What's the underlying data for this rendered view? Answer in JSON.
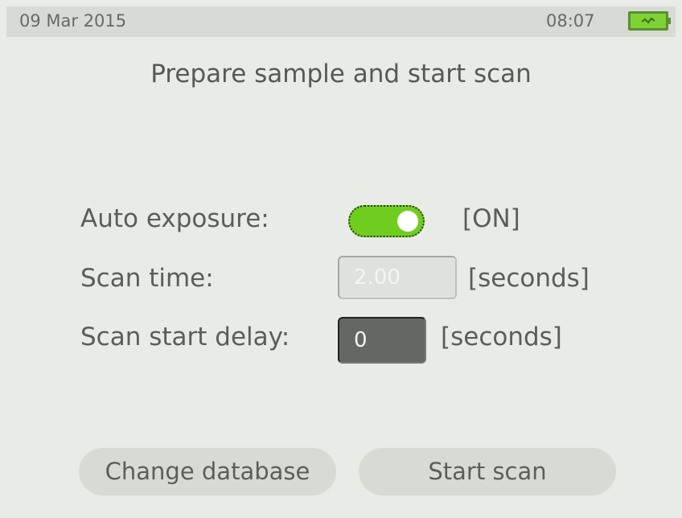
{
  "status": {
    "date": "09 Mar 2015",
    "time": "08:07",
    "battery_icon": "battery-icon"
  },
  "title": "Prepare sample and start scan",
  "settings": {
    "auto_exposure": {
      "label": "Auto exposure:",
      "state": "[ON]",
      "toggle_on": true
    },
    "scan_time": {
      "label": "Scan time:",
      "value": "2.00",
      "unit": "[seconds]",
      "enabled": false
    },
    "scan_delay": {
      "label": "Scan start delay:",
      "value": "0",
      "unit": "[seconds]",
      "enabled": true
    }
  },
  "buttons": {
    "change_database": "Change database",
    "start_scan": "Start scan"
  },
  "colors": {
    "accent": "#6fcd1f",
    "background": "#e9ece6",
    "statusbar": "#d7dad5"
  }
}
